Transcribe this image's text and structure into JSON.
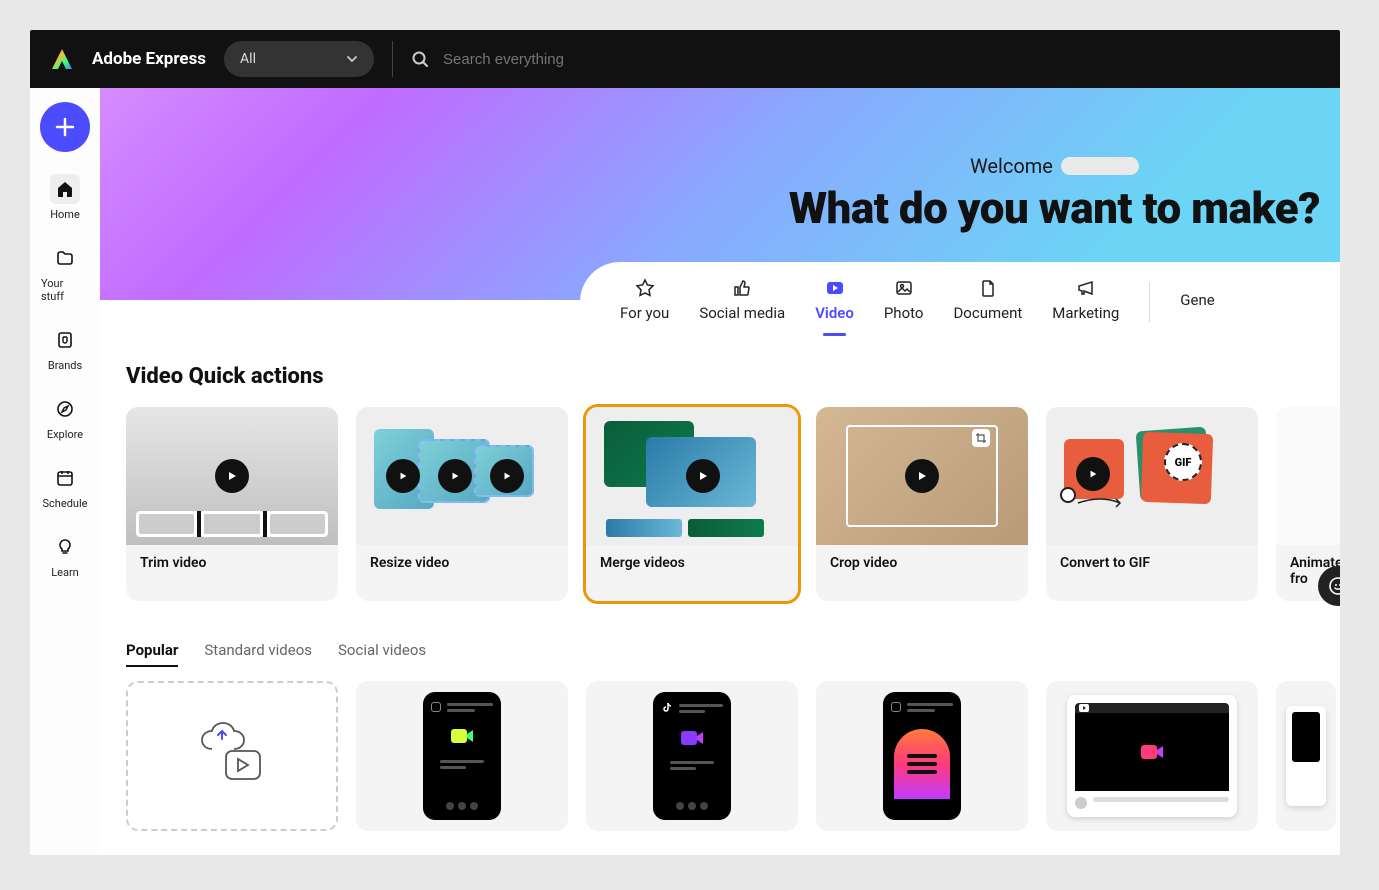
{
  "header": {
    "app_title": "Adobe Express",
    "filter_label": "All",
    "search_placeholder": "Search everything"
  },
  "sidebar": {
    "items": [
      {
        "id": "home",
        "label": "Home",
        "active": true
      },
      {
        "id": "your-stuff",
        "label": "Your stuff"
      },
      {
        "id": "brands",
        "label": "Brands"
      },
      {
        "id": "explore",
        "label": "Explore"
      },
      {
        "id": "schedule",
        "label": "Schedule"
      },
      {
        "id": "learn",
        "label": "Learn"
      }
    ]
  },
  "hero": {
    "welcome_label": "Welcome",
    "headline": "What do you want to make?"
  },
  "categories": [
    {
      "id": "for-you",
      "label": "For you",
      "active": false
    },
    {
      "id": "social",
      "label": "Social media",
      "active": false
    },
    {
      "id": "video",
      "label": "Video",
      "active": true
    },
    {
      "id": "photo",
      "label": "Photo",
      "active": false
    },
    {
      "id": "document",
      "label": "Document",
      "active": false
    },
    {
      "id": "marketing",
      "label": "Marketing",
      "active": false
    },
    {
      "id": "generate",
      "label": "Gene",
      "active": false
    }
  ],
  "quick_actions": {
    "title": "Video Quick actions",
    "cards": [
      {
        "id": "trim",
        "label": "Trim video",
        "highlight": false
      },
      {
        "id": "resize",
        "label": "Resize video",
        "highlight": false
      },
      {
        "id": "merge",
        "label": "Merge videos",
        "highlight": true
      },
      {
        "id": "crop",
        "label": "Crop video",
        "highlight": false
      },
      {
        "id": "gif",
        "label": "Convert to GIF",
        "highlight": false,
        "badge": "GIF"
      },
      {
        "id": "animate",
        "label": "Animate fro",
        "highlight": false
      }
    ]
  },
  "template_tabs": [
    {
      "id": "popular",
      "label": "Popular",
      "active": true
    },
    {
      "id": "standard",
      "label": "Standard videos",
      "active": false
    },
    {
      "id": "social-vid",
      "label": "Social videos",
      "active": false
    }
  ],
  "colors": {
    "accent": "#4b4bff",
    "highlight_border": "#e8990a"
  }
}
